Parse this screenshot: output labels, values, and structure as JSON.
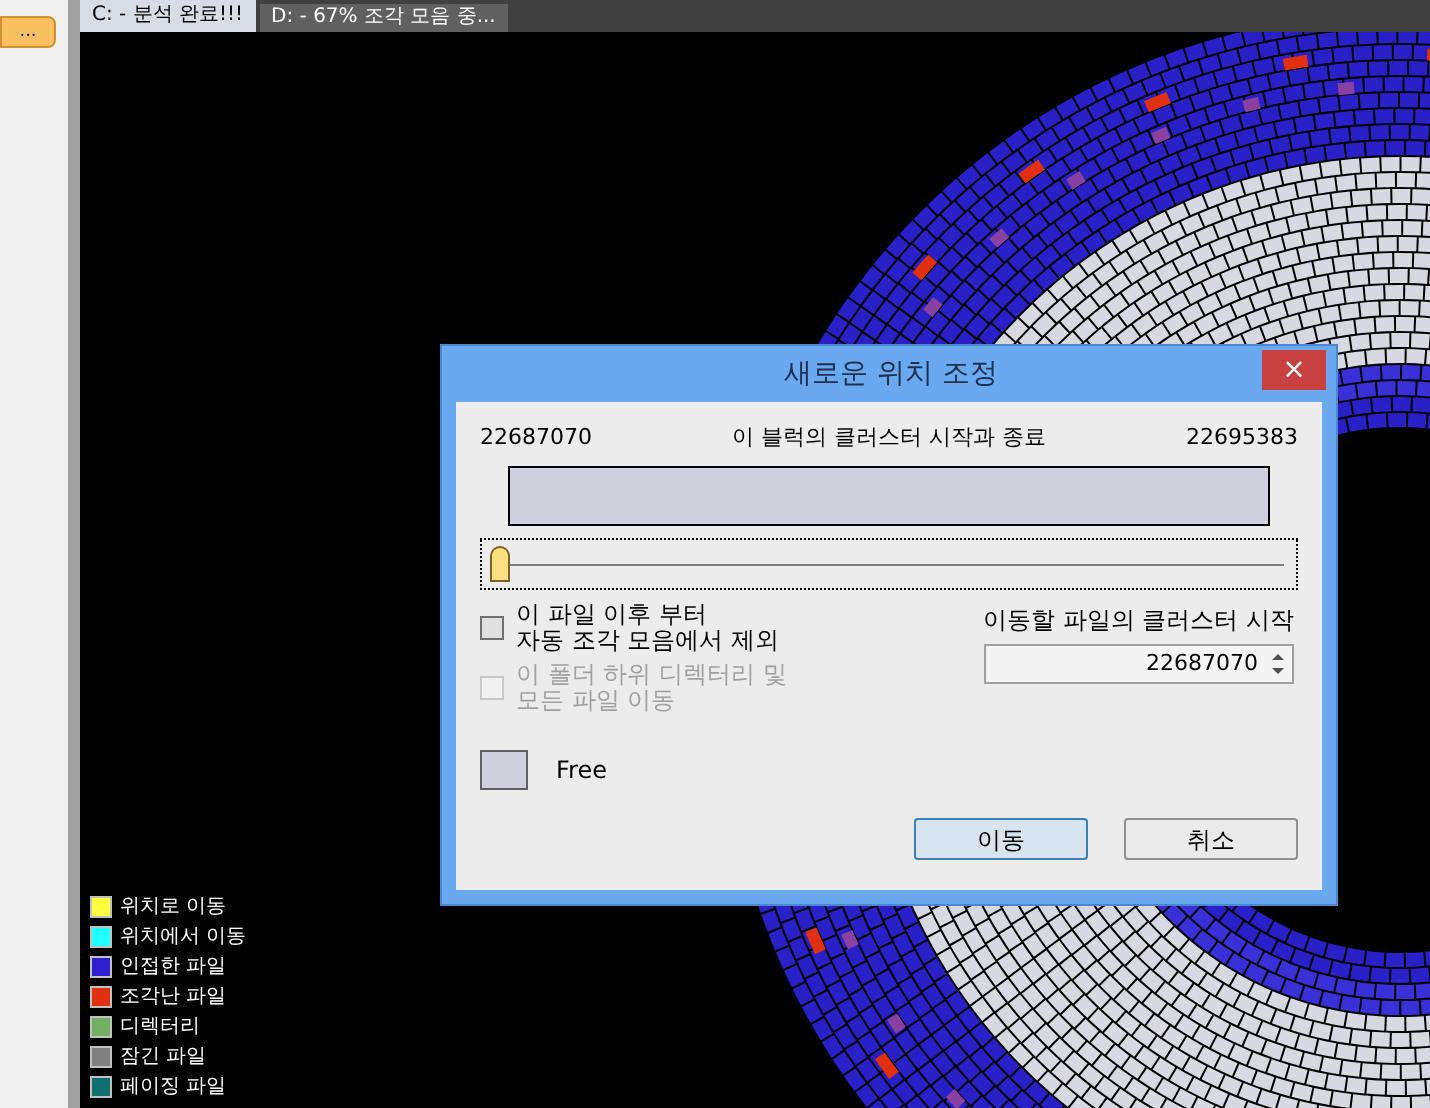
{
  "side_button": {
    "label": "..."
  },
  "tabs": [
    {
      "label": "C: - 분석 완료!!!",
      "selected": true
    },
    {
      "label": "D: - 67% 조각 모음 중...",
      "selected": false
    }
  ],
  "legend": [
    {
      "label": "위치로 이동",
      "color": "#ffff40"
    },
    {
      "label": "위치에서 이동",
      "color": "#20ffff"
    },
    {
      "label": "인접한 파일",
      "color": "#3020d0"
    },
    {
      "label": "조각난 파일",
      "color": "#e03010"
    },
    {
      "label": "디렉터리",
      "color": "#70b060"
    },
    {
      "label": "잠긴 파일",
      "color": "#808080"
    },
    {
      "label": "페이징 파일",
      "color": "#107070"
    }
  ],
  "dialog": {
    "title": "새로운 위치 조정",
    "close": "×",
    "start": "22687070",
    "caption": "이 블럭의 클러스터 시작과 종료",
    "end": "22695383",
    "slider": {
      "level": 0.0
    },
    "checkboxes": [
      {
        "label": "이 파일 이후 부터\n자동 조각 모음에서 제외",
        "checked": false,
        "disabled": false
      },
      {
        "label": "이 폴더 하위 디렉터리 및\n모든 파일 이동",
        "checked": false,
        "disabled": true
      }
    ],
    "target_label": "이동할 파일의 클러스터 시작",
    "target_value": "22687070",
    "swatch": {
      "label": "Free",
      "color": "#d0d0dc"
    },
    "buttons": [
      {
        "label": "이동",
        "selected": true
      },
      {
        "label": "취소",
        "selected": false
      }
    ]
  }
}
